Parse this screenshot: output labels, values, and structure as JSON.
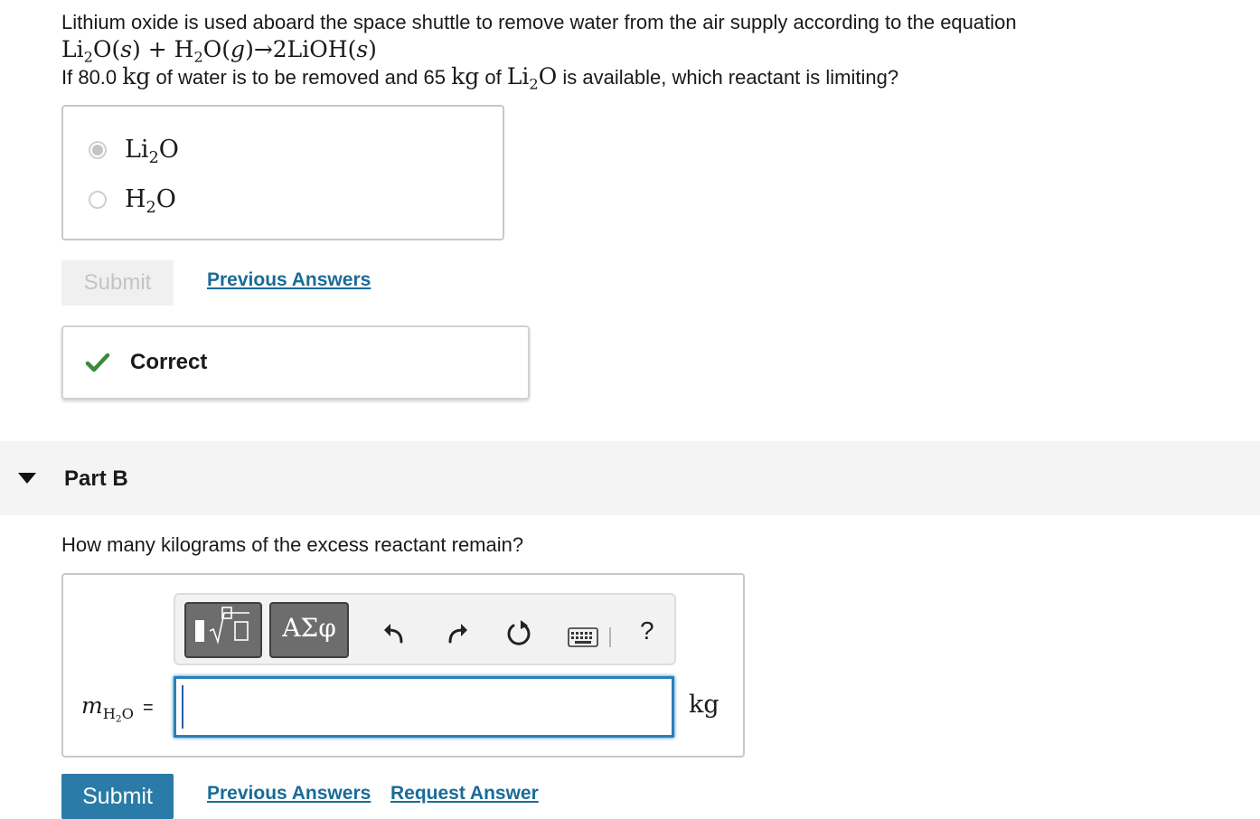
{
  "part_a": {
    "question_line1": "Lithium oxide is used aboard the space shuttle to remove water from the air supply according to the equation",
    "equation": {
      "li2o": "Li",
      "li2o_sub": "2",
      "li2o_o": "O(",
      "s1": "s",
      "close1": ") + H",
      "h2o_sub": "2",
      "h2o_o": "O(",
      "g": "g",
      "close2": ")→2LiOH(",
      "s2": "s",
      "close3": ")"
    },
    "question_line3": {
      "pre": "If 80.0 ",
      "kg1": "kg",
      "mid": " of water is to be removed and 65 ",
      "kg2": "kg",
      "of": " of ",
      "li": "Li",
      "li_sub": "2",
      "o": "O",
      "post": " is available, which reactant is limiting?"
    },
    "choices": [
      {
        "base": "Li",
        "sub": "2",
        "tail": "O",
        "selected": true
      },
      {
        "base": "H",
        "sub": "2",
        "tail": "O",
        "selected": false
      }
    ],
    "submit_label": "Submit",
    "previous_answers_label": "Previous Answers",
    "feedback": "Correct"
  },
  "part_b": {
    "title": "Part B",
    "prompt": "How many kilograms of the excess reactant remain?",
    "toolbar": {
      "symbols_label": "ΑΣφ",
      "help_label": "?"
    },
    "variable": {
      "m": "m",
      "h": "H",
      "sub": "2",
      "o": "O",
      "eq": "="
    },
    "input_value": "",
    "unit": "kg",
    "submit_label": "Submit",
    "previous_answers_label": "Previous Answers",
    "request_answer_label": "Request Answer"
  },
  "colors": {
    "link": "#1a6b97",
    "submit_bg": "#2a7ba8",
    "check": "#3a8a3a",
    "input_border": "#2b7fb8"
  }
}
